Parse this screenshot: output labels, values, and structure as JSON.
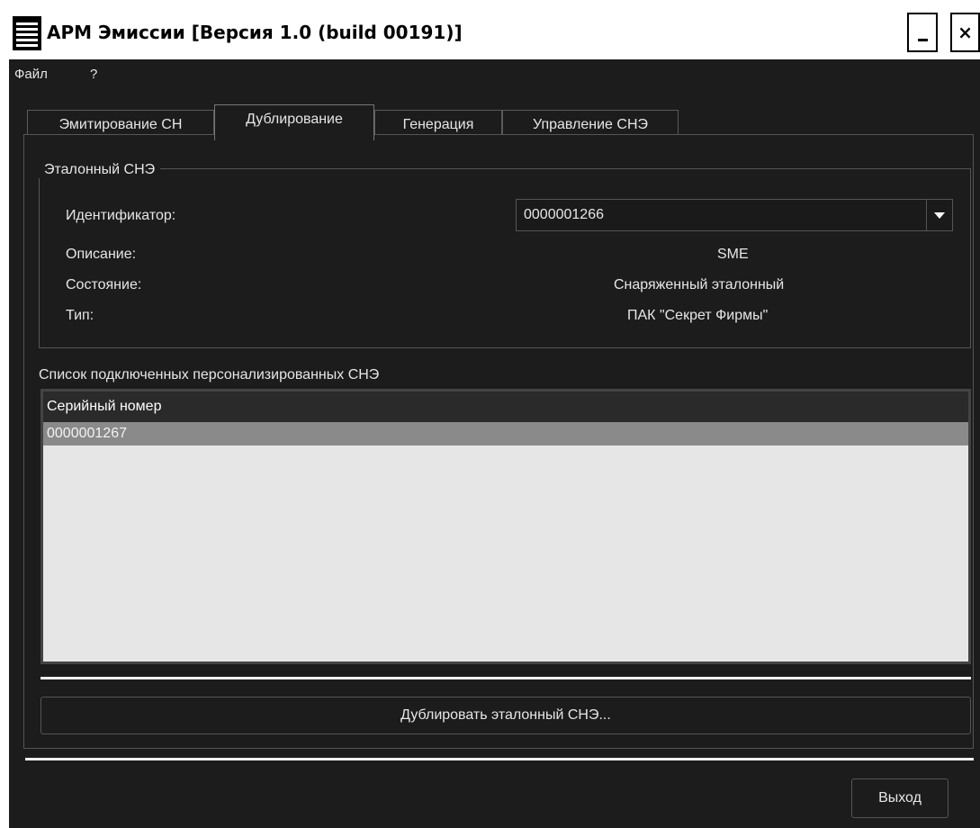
{
  "window": {
    "title": "АРМ Эмиссии [Версия 1.0 (build 00191)]",
    "minimize_label": "_",
    "close_label": "×"
  },
  "menu": [
    "Файл",
    "?"
  ],
  "tabs": [
    {
      "label": "Эмитирование СН",
      "active": false
    },
    {
      "label": "Дублирование",
      "active": true
    },
    {
      "label": "Генерация",
      "active": false
    },
    {
      "label": "Управление СНЭ",
      "active": false
    }
  ],
  "reference": {
    "group_title": "Эталонный СНЭ",
    "identifier_label": "Идентификатор:",
    "identifier_value": "0000001266",
    "description_label": "Описание:",
    "description_value": "SME",
    "state_label": "Состояние:",
    "state_value": "Снаряженный эталонный",
    "type_label": "Тип:",
    "type_value": "ПАК \"Секрет Фирмы\""
  },
  "list": {
    "title": "Список подключенных персонализированных СНЭ",
    "column_header": "Серийный номер",
    "rows": [
      "0000001267"
    ]
  },
  "actions": {
    "duplicate_label": "Дублировать эталонный СНЭ...",
    "exit_label": "Выход"
  },
  "colors": {
    "background": "#1c1c1c",
    "selected_row": "#8a8a8a",
    "list_background": "#e6e6e6"
  }
}
